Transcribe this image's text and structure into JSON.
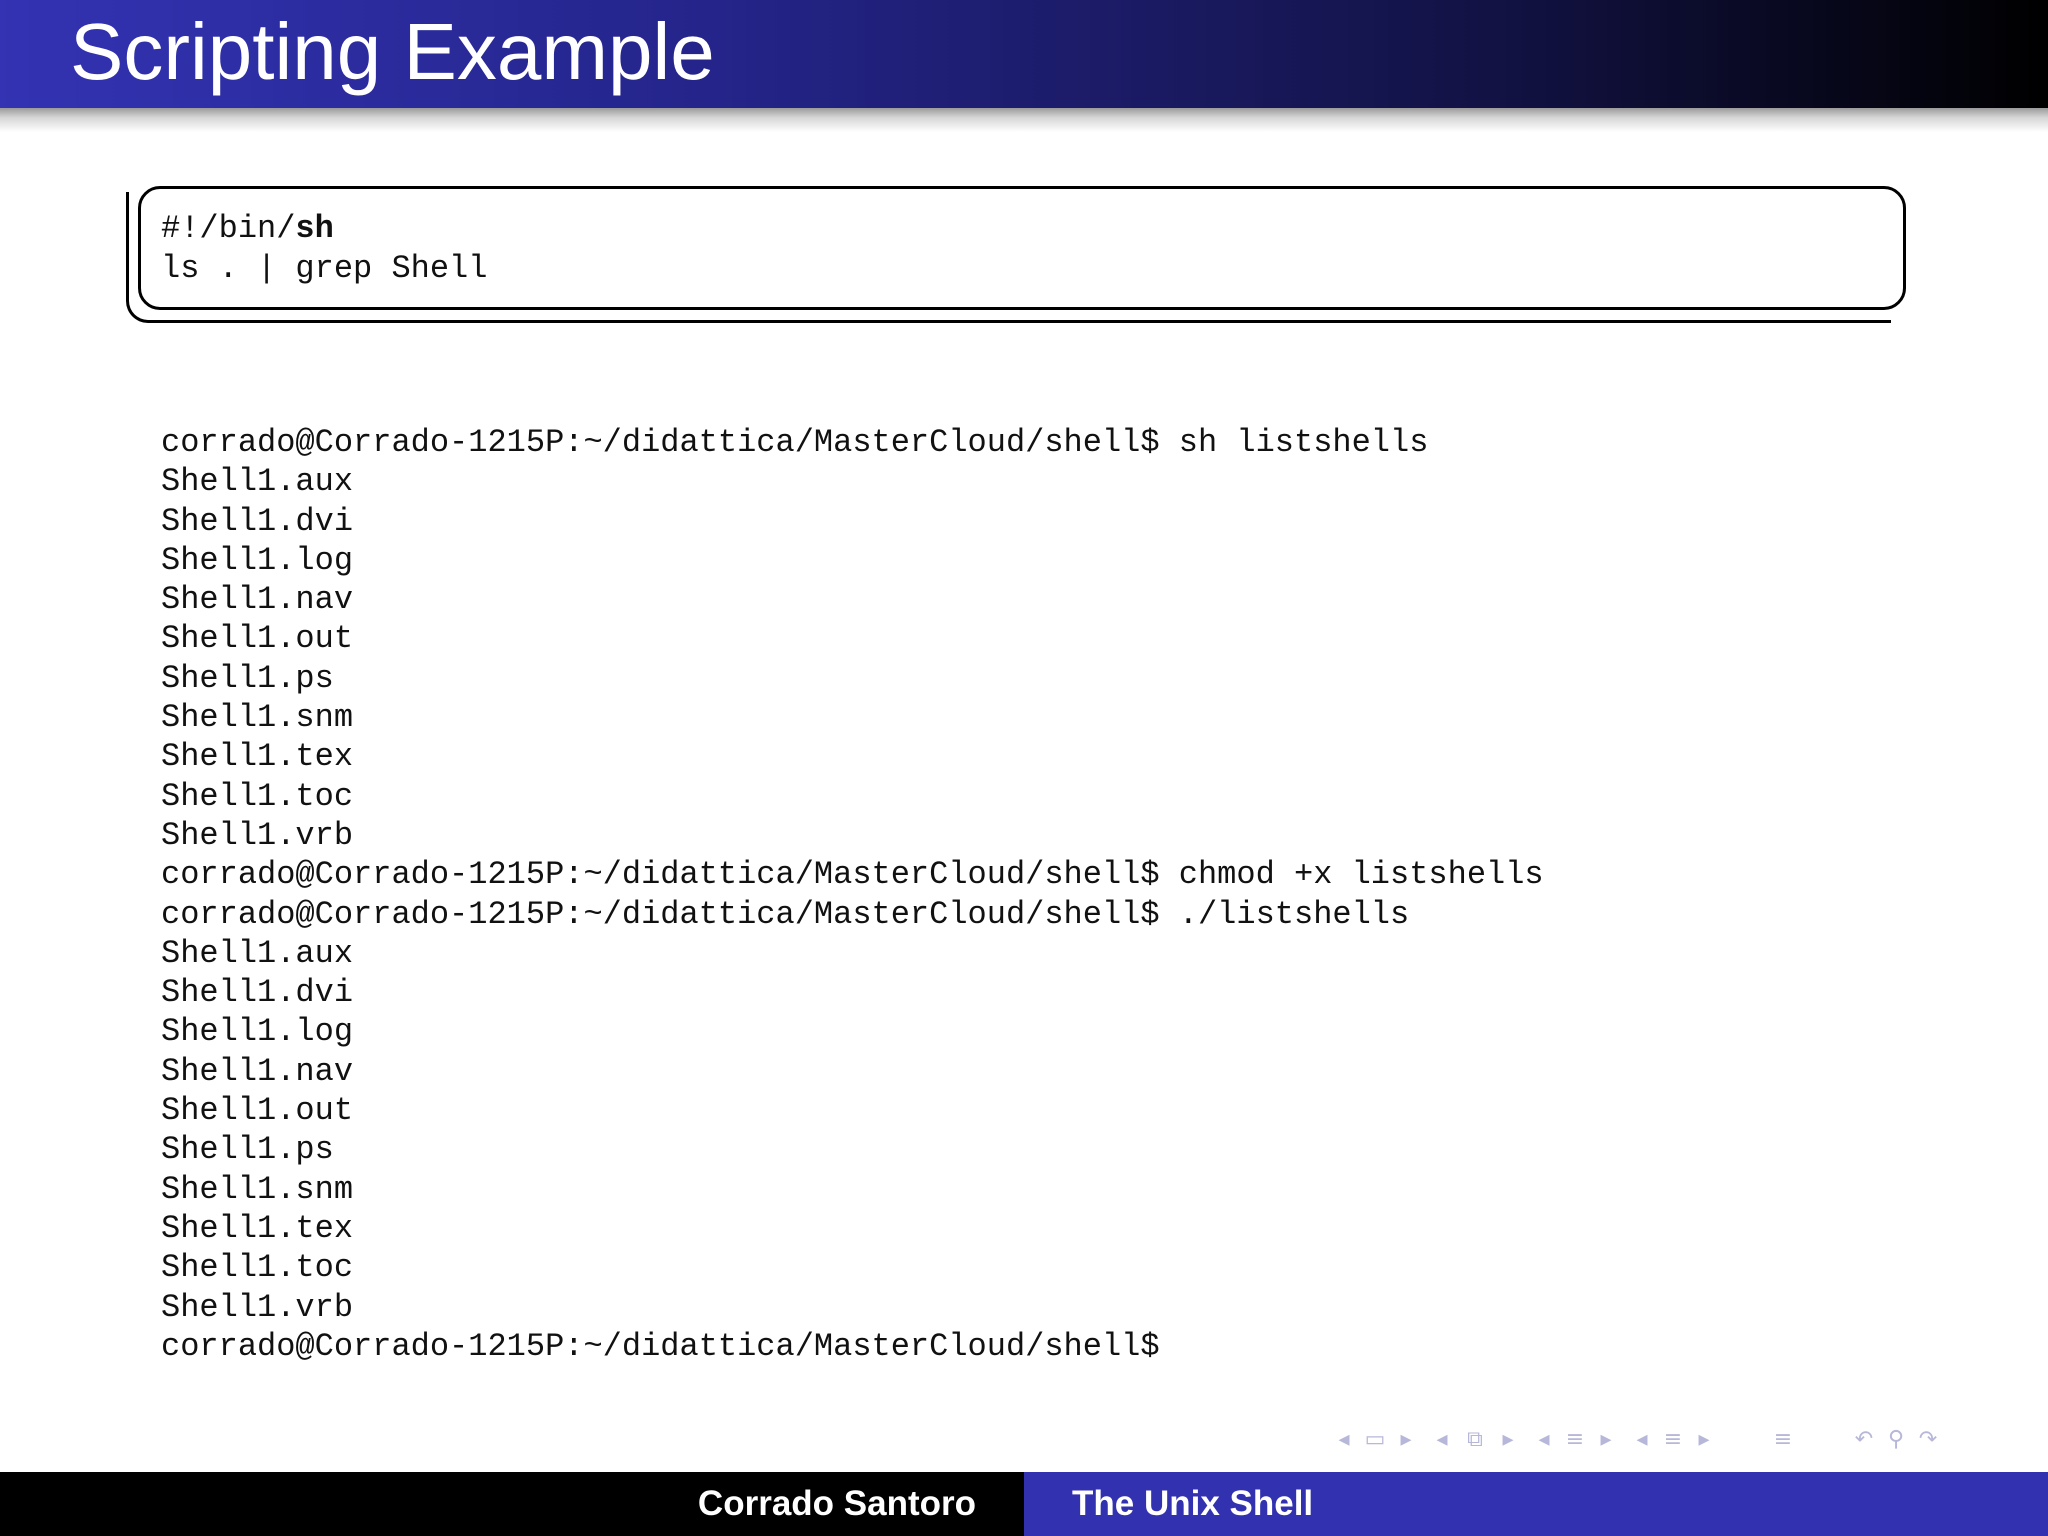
{
  "slide": {
    "title": "Scripting Example"
  },
  "script_box": {
    "line1_prefix": "#!/bin/",
    "line1_bold": "sh",
    "line2": "ls . | grep Shell"
  },
  "terminal": {
    "lines": [
      "corrado@Corrado-1215P:~/didattica/MasterCloud/shell$ sh listshells",
      "Shell1.aux",
      "Shell1.dvi",
      "Shell1.log",
      "Shell1.nav",
      "Shell1.out",
      "Shell1.ps",
      "Shell1.snm",
      "Shell1.tex",
      "Shell1.toc",
      "Shell1.vrb",
      "corrado@Corrado-1215P:~/didattica/MasterCloud/shell$ chmod +x listshells",
      "corrado@Corrado-1215P:~/didattica/MasterCloud/shell$ ./listshells",
      "Shell1.aux",
      "Shell1.dvi",
      "Shell1.log",
      "Shell1.nav",
      "Shell1.out",
      "Shell1.ps",
      "Shell1.snm",
      "Shell1.tex",
      "Shell1.toc",
      "Shell1.vrb",
      "corrado@Corrado-1215P:~/didattica/MasterCloud/shell$"
    ]
  },
  "navigation": {
    "icons": [
      "arrow-left-icon",
      "frame-icon",
      "arrow-right-icon",
      "arrow-left-icon",
      "subsection-icon",
      "arrow-right-icon",
      "arrow-left-icon",
      "section-icon",
      "arrow-right-icon",
      "arrow-left-icon",
      "section-icon",
      "arrow-right-icon",
      "appendix-icon",
      "back-icon",
      "search-icon",
      "forward-icon"
    ]
  },
  "footer": {
    "author": "Corrado Santoro",
    "title": "The Unix Shell"
  },
  "colors": {
    "title_gradient_start": "#3333b3",
    "title_gradient_end": "#000000",
    "footer_left": "#000000",
    "footer_right": "#3232b0",
    "nav_icons": "#b7b7d9"
  }
}
